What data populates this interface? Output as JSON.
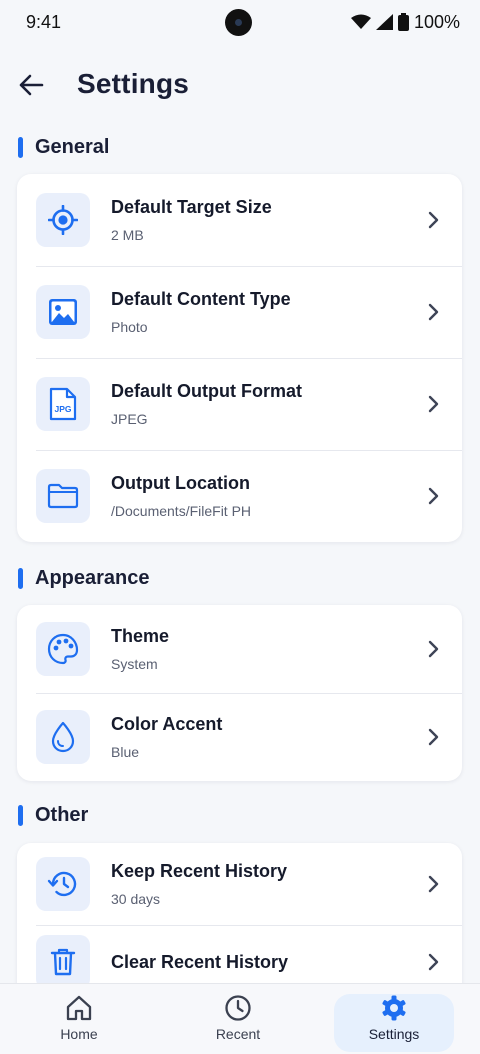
{
  "status_bar": {
    "time": "9:41",
    "battery": "100%"
  },
  "header": {
    "title": "Settings"
  },
  "sections": [
    {
      "title": "General",
      "items": [
        {
          "title": "Default Target Size",
          "subtitle": "2 MB",
          "icon": "target-icon"
        },
        {
          "title": "Default Content Type",
          "subtitle": "Photo",
          "icon": "image-icon"
        },
        {
          "title": "Default Output Format",
          "subtitle": "JPEG",
          "icon": "jpg-file-icon",
          "icon_text": "JPG"
        },
        {
          "title": "Output Location",
          "subtitle": "/Documents/FileFit PH",
          "icon": "folder-icon"
        }
      ]
    },
    {
      "title": "Appearance",
      "items": [
        {
          "title": "Theme",
          "subtitle": "System",
          "icon": "palette-icon"
        },
        {
          "title": "Color Accent",
          "subtitle": "Blue",
          "icon": "droplet-icon"
        }
      ]
    },
    {
      "title": "Other",
      "items": [
        {
          "title": "Keep Recent History",
          "subtitle": "30 days",
          "icon": "history-icon"
        },
        {
          "title": "Clear Recent History",
          "icon": "trash-icon"
        }
      ]
    }
  ],
  "bottom_nav": [
    {
      "label": "Home",
      "icon": "home-icon"
    },
    {
      "label": "Recent",
      "icon": "clock-icon"
    },
    {
      "label": "Settings",
      "icon": "gear-icon",
      "active": true
    }
  ],
  "colors": {
    "accent": "#1e6ef0",
    "background": "#f5f7fa",
    "icon_bg": "#e9effb"
  }
}
